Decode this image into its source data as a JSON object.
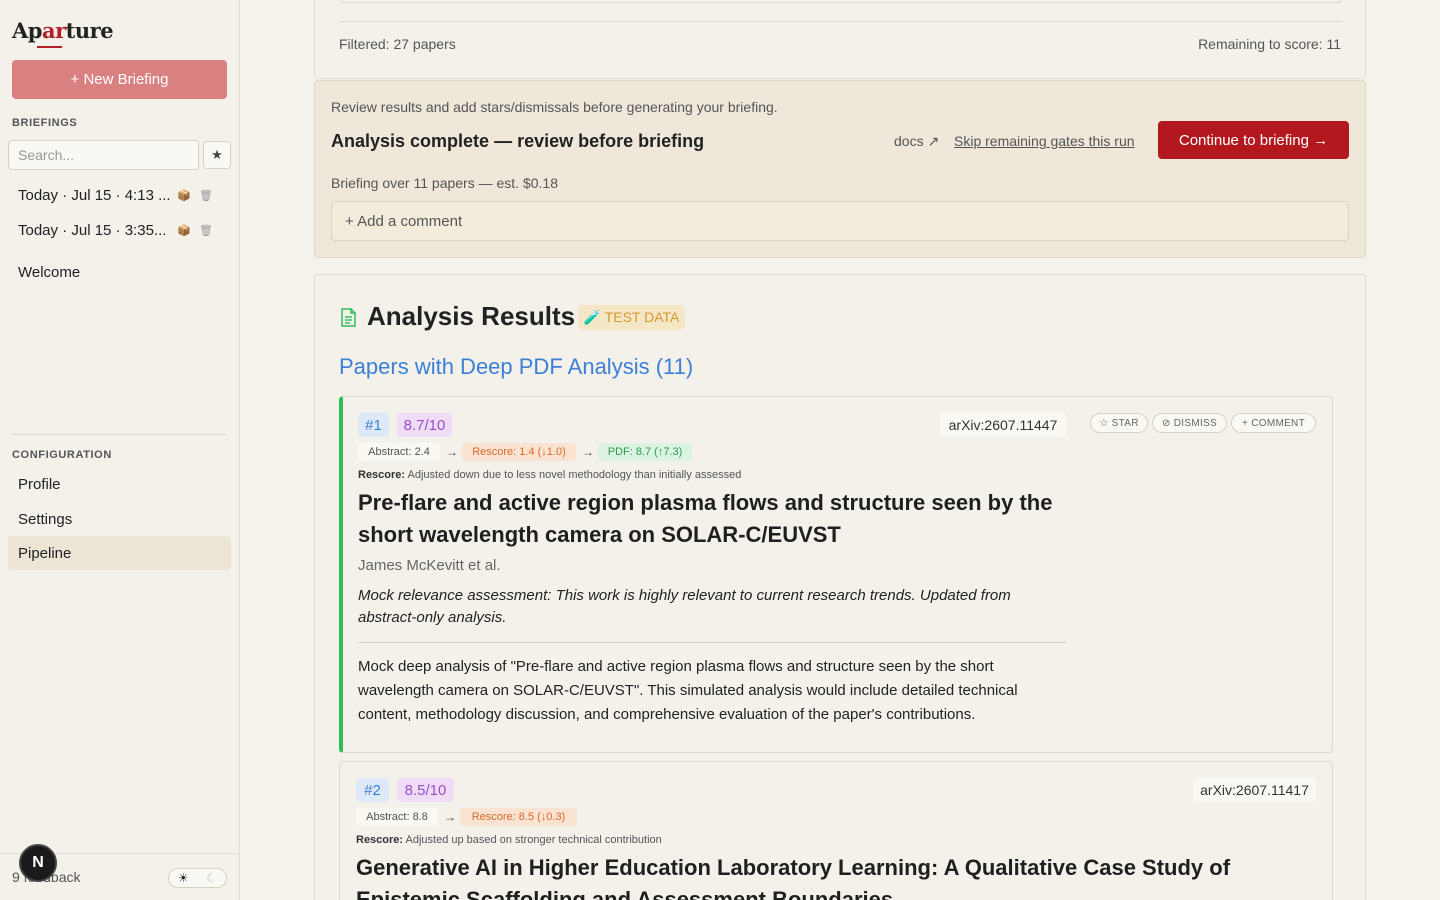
{
  "app": {
    "logo": {
      "pre": "Ap",
      "accent": "ar",
      "post": "ture"
    },
    "accent_color": "#b3181f"
  },
  "sidebar": {
    "new_briefing_label": "+ New Briefing",
    "briefings_label": "BRIEFINGS",
    "search_placeholder": "Search...",
    "star_filter_icon": "★",
    "briefings": [
      {
        "label": "Today · Jul 15 · 4:13 ...",
        "archive_icon": "📦",
        "delete_icon": "🗑"
      },
      {
        "label": "Today · Jul 15 · 3:35...",
        "archive_icon": "📦",
        "delete_icon": "🗑"
      }
    ],
    "welcome_label": "Welcome",
    "configuration_label": "CONFIGURATION",
    "nav": [
      {
        "label": "Profile"
      },
      {
        "label": "Settings"
      },
      {
        "label": "Pipeline",
        "active": true
      }
    ],
    "feedback_label": "9 feedback",
    "avatar_letter": "N",
    "theme": {
      "light_icon": "☀",
      "dark_icon": "☾"
    }
  },
  "filter_bar": {
    "filtered": "Filtered: 27 papers",
    "remaining": "Remaining to score: 11"
  },
  "review": {
    "hint": "Review results and add stars/dismissals before generating your briefing.",
    "title": "Analysis complete — review before briefing",
    "docs_label": "docs ↗",
    "skip_label": "Skip remaining gates this run",
    "continue_label": "Continue to briefing →",
    "estimate": "Briefing over 11 papers — est. $0.18",
    "comment_label": "+ Add a comment"
  },
  "results": {
    "title": "Analysis Results",
    "test_badge": "🧪 TEST DATA",
    "section_title": "Papers with Deep PDF Analysis (11)",
    "papers": [
      {
        "rank": "#1",
        "score": "8.7/10",
        "arxiv": "arXiv:2607.11447",
        "actions": {
          "star": "☆ STAR",
          "dismiss": "⊘ DISMISS",
          "comment": "+ COMMENT"
        },
        "abstract_score": "Abstract: 2.4",
        "rescore": "Rescore: 1.4 (↓1.0)",
        "pdf_score": "PDF: 8.7 (↑7.3)",
        "arrow": "→",
        "rescore_label": "Rescore:",
        "rescore_note": "Adjusted down due to less novel methodology than initially assessed",
        "title": "Pre-flare and active region plasma flows and structure seen by the short wavelength camera on SOLAR-C/EUVST",
        "authors": "James McKevitt et al.",
        "assessment": "Mock relevance assessment: This work is highly relevant to current research trends. Updated from abstract-only analysis.",
        "deep_analysis": "Mock deep analysis of \"Pre-flare and active region plasma flows and structure seen by the short wavelength camera on SOLAR-C/EUVST\". This simulated analysis would include detailed technical content, methodology discussion, and comprehensive evaluation of the paper's contributions."
      },
      {
        "rank": "#2",
        "score": "8.5/10",
        "arxiv": "arXiv:2607.11417",
        "abstract_score": "Abstract: 8.8",
        "rescore": "Rescore: 8.5 (↓0.3)",
        "arrow": "→",
        "rescore_label": "Rescore:",
        "rescore_note": "Adjusted up based on stronger technical contribution",
        "title": "Generative AI in Higher Education Laboratory Learning: A Qualitative Case Study of Epistemic Scaffolding and Assessment Boundaries"
      }
    ]
  }
}
